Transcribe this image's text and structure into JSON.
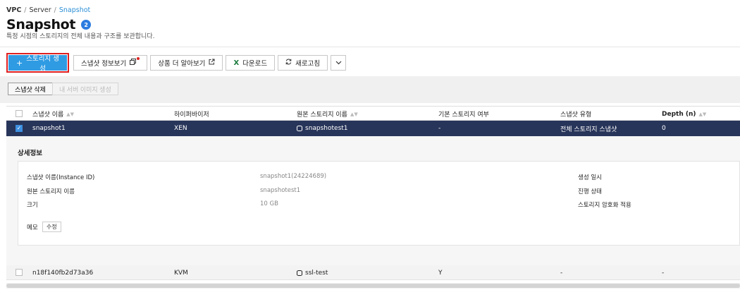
{
  "breadcrumb": {
    "items": [
      "VPC",
      "Server",
      "Snapshot"
    ],
    "separator": "/"
  },
  "header": {
    "title": "Snapshot",
    "count_badge": "2",
    "description": "특정 시점의 스토리지의 전체 내용과 구조를 보관합니다."
  },
  "toolbar": {
    "create_label": "스토리지 생성",
    "create_icon": "+",
    "info_label": "스냅샷 정보보기",
    "learn_more_label": "상품 더 알아보기",
    "download_label": "다운로드",
    "download_icon": "X",
    "refresh_label": "새로고침"
  },
  "subtoolbar": {
    "delete_label": "스냅샷 삭제",
    "create_image_label": "내 서버 이미지 생성"
  },
  "table": {
    "columns": [
      "스냅샷 이름",
      "하이퍼바이저",
      "원본 스토리지 이름",
      "기본 스토리지 여부",
      "스냅샷 유형",
      "Depth (n)"
    ],
    "rows": [
      {
        "name": "snapshot1",
        "hypervisor": "XEN",
        "source_storage": "snapshotest1",
        "is_default": "-",
        "type": "전체 스토리지 스냅샷",
        "depth": "0"
      },
      {
        "name": "n18f140fb2d73a36",
        "hypervisor": "KVM",
        "source_storage": "ssl-test",
        "is_default": "Y",
        "type": "-",
        "depth": "-"
      }
    ]
  },
  "detail": {
    "title": "상세정보",
    "instance_label": "스냅샷 이름(Instance ID)",
    "instance_value": "snapshot1(24224689)",
    "source_label": "원본 스토리지 이름",
    "source_value": "snapshotest1",
    "size_label": "크기",
    "size_value": "10 GB",
    "created_label": "생성 일시",
    "status_label": "진행 상태",
    "encryption_label": "스토리지 암호화 적용",
    "memo_label": "메모",
    "edit_label": "수정"
  },
  "colors": {
    "accent": "#2f9be3",
    "selected_row": "#28355a",
    "highlight_border": "#e02020",
    "badge": "#2b7ce0"
  }
}
